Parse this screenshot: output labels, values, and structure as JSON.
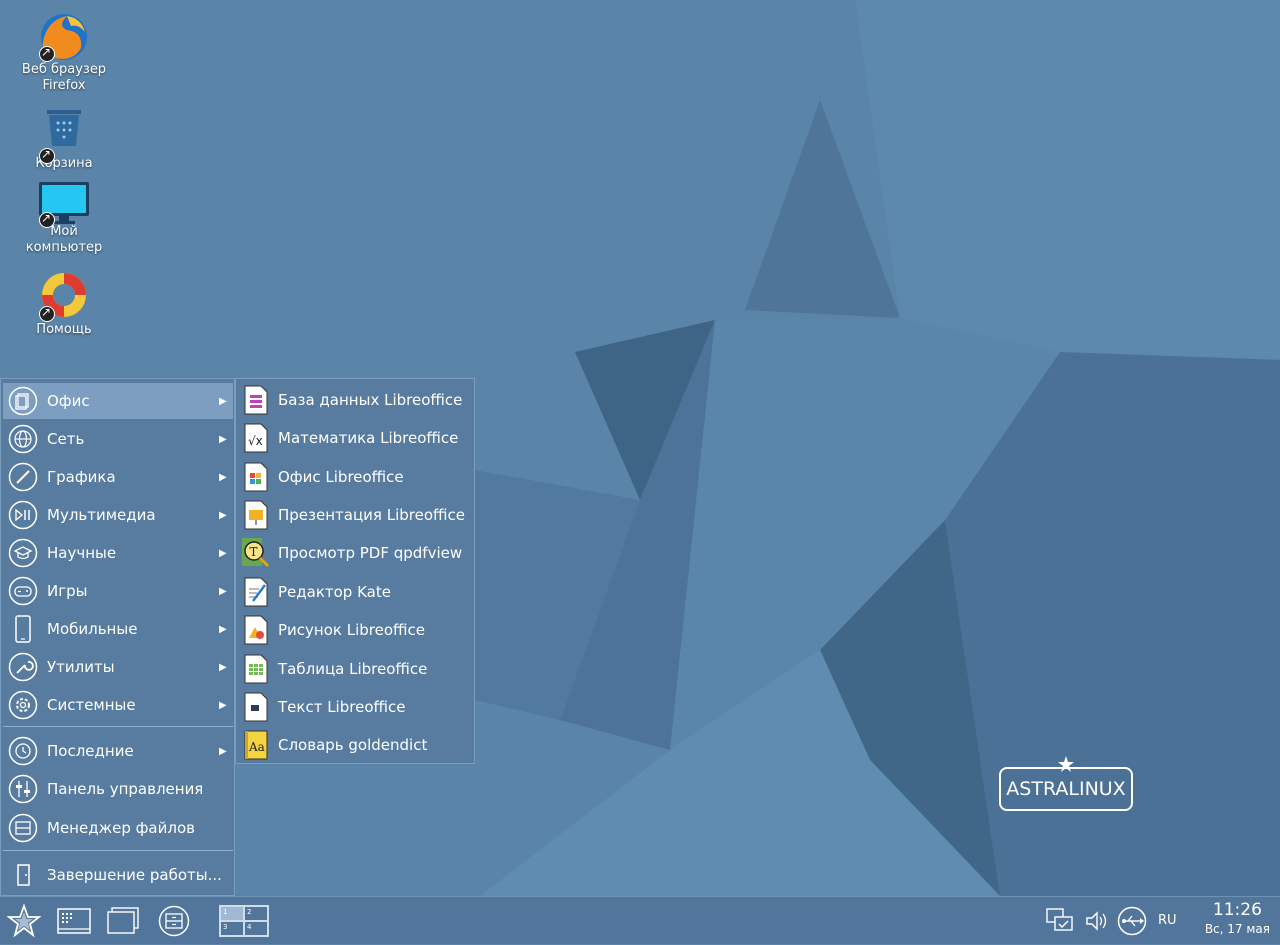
{
  "desktop": {
    "icons": [
      {
        "label_line1": "Веб браузер",
        "label_line2": "Firefox"
      },
      {
        "label_line1": "Корзина",
        "label_line2": ""
      },
      {
        "label_line1": "Мой",
        "label_line2": "компьютер"
      },
      {
        "label_line1": "Помощь",
        "label_line2": ""
      }
    ],
    "logo_text": "ASTRALINUX"
  },
  "start_menu": {
    "categories": [
      {
        "label": "Офис",
        "icon": "office-icon"
      },
      {
        "label": "Сеть",
        "icon": "network-icon"
      },
      {
        "label": "Графика",
        "icon": "graphics-icon"
      },
      {
        "label": "Мультимедиа",
        "icon": "multimedia-icon"
      },
      {
        "label": "Научные",
        "icon": "science-icon"
      },
      {
        "label": "Игры",
        "icon": "games-icon"
      },
      {
        "label": "Мобильные",
        "icon": "mobile-icon"
      },
      {
        "label": "Утилиты",
        "icon": "utilities-icon"
      },
      {
        "label": "Системные",
        "icon": "system-icon"
      }
    ],
    "extra": [
      {
        "label": "Последние",
        "icon": "recent-icon"
      },
      {
        "label": "Панель управления",
        "icon": "control-panel-icon"
      },
      {
        "label": "Менеджер файлов",
        "icon": "file-manager-icon"
      }
    ],
    "shutdown_label": "Завершение работы..."
  },
  "submenu": {
    "items": [
      {
        "label": "База данных Libreoffice",
        "icon": "libreoffice-base-icon"
      },
      {
        "label": "Математика Libreoffice",
        "icon": "libreoffice-math-icon"
      },
      {
        "label": "Офис Libreoffice",
        "icon": "libreoffice-icon"
      },
      {
        "label": "Презентация Libreoffice",
        "icon": "libreoffice-impress-icon"
      },
      {
        "label": "Просмотр PDF qpdfview",
        "icon": "qpdfview-icon"
      },
      {
        "label": "Редактор Kate",
        "icon": "kate-icon"
      },
      {
        "label": "Рисунок Libreoffice",
        "icon": "libreoffice-draw-icon"
      },
      {
        "label": "Таблица Libreoffice",
        "icon": "libreoffice-calc-icon"
      },
      {
        "label": "Текст Libreoffice",
        "icon": "libreoffice-writer-icon"
      },
      {
        "label": "Словарь goldendict",
        "icon": "goldendict-icon"
      }
    ]
  },
  "taskbar": {
    "pager": [
      "1",
      "2",
      "3",
      "4"
    ],
    "lang": "RU",
    "time": "11:26",
    "date": "Вс, 17 мая"
  }
}
